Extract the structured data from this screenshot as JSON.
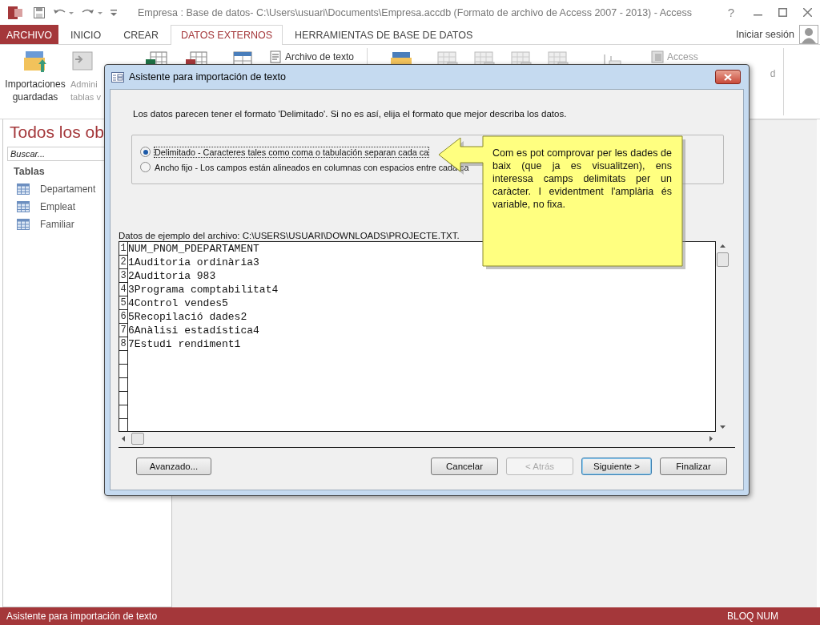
{
  "window": {
    "title": "Empresa : Base de datos- C:\\Users\\usuari\\Documents\\Empresa.accdb (Formato de archivo de Access 2007 - 2013) - Access",
    "help": "?"
  },
  "tabs": [
    {
      "label": "ARCHIVO",
      "kind": "file",
      "selected": false
    },
    {
      "label": "INICIO",
      "kind": "tab",
      "selected": false
    },
    {
      "label": "CREAR",
      "kind": "tab",
      "selected": false
    },
    {
      "label": "DATOS EXTERNOS",
      "kind": "tab",
      "selected": true
    },
    {
      "label": "HERRAMIENTAS DE BASE DE DATOS",
      "kind": "tab",
      "selected": false
    }
  ],
  "account": {
    "label": "Iniciar sesión"
  },
  "ribbon": {
    "large_buttons": [
      {
        "label": "Importaciones guardadas",
        "disabled": false
      },
      {
        "label": "Admini\ntablas v",
        "disabled": true
      }
    ],
    "text_file": {
      "label": "Archivo de texto",
      "disabled": false
    },
    "access_export": {
      "label": "Access",
      "disabled": true
    },
    "edge_label": "d"
  },
  "nav_pane": {
    "title": "Todos los ob",
    "search": {
      "placeholder": "Buscar..."
    },
    "group": "Tablas",
    "items": [
      {
        "label": "Departament"
      },
      {
        "label": "Empleat"
      },
      {
        "label": "Familiar"
      }
    ]
  },
  "dialog": {
    "title": "Asistente para importación de texto",
    "intro": "Los datos parecen tener el formato 'Delimitado'. Si no es así, elija el formato que mejor describa los datos.",
    "options": [
      {
        "label": "Delimitado - Caracteres tales como coma o tabulación separan cada ca",
        "selected": true
      },
      {
        "label": "Ancho fijo - Los campos están alineados en columnas con espacios entre cada ca",
        "selected": false
      }
    ],
    "preview": {
      "label": "Datos de ejemplo del archivo: C:\\USERS\\USUARI\\DOWNLOADS\\PROJECTE.TXT.",
      "lines": [
        {
          "number": "1",
          "text": "NUM_PNOM_PDEPARTAMENT"
        },
        {
          "number": "2",
          "text": "1Auditoria ordinària3"
        },
        {
          "number": "3",
          "text": "2Auditoria 983"
        },
        {
          "number": "4",
          "text": "3Programa comptabilitat4"
        },
        {
          "number": "5",
          "text": "4Control vendes5"
        },
        {
          "number": "6",
          "text": "5Recopilació dades2"
        },
        {
          "number": "7",
          "text": "6Anàlisi estadística4"
        },
        {
          "number": "8",
          "text": "7Estudi rendiment1"
        }
      ]
    },
    "buttons": [
      {
        "label": "Avanzado...",
        "disabled": false,
        "default": false
      },
      {
        "label": "Cancelar",
        "disabled": false,
        "default": false
      },
      {
        "label": "< Atrás",
        "disabled": true,
        "default": false
      },
      {
        "label": "Siguiente >",
        "disabled": false,
        "default": true
      },
      {
        "label": "Finalizar",
        "disabled": false,
        "default": false
      }
    ]
  },
  "callout": {
    "text": "Com es pot comprovar per les dades de baix (que ja es visualitzen), ens interessa camps delimitats per un caràcter. I evidentment l'amplària és variable, no fixa."
  },
  "status_bar": {
    "left": "Asistente para importación de texto",
    "right": "BLOQ NUM"
  }
}
